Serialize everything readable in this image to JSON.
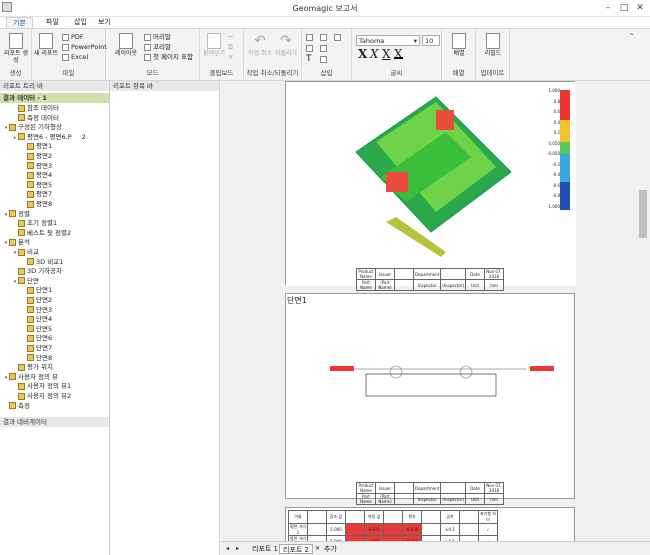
{
  "app": {
    "title": "Geomagic 보고서"
  },
  "tabs": [
    "기본",
    "파일",
    "삽입",
    "보기"
  ],
  "ribbon": {
    "create": {
      "label": "생성",
      "btn": "리포트 생성"
    },
    "file": {
      "label": "파일",
      "new": "새 리포트",
      "pdf": "PDF",
      "ppt": "PowerPoint",
      "excel": "Excel"
    },
    "mode": {
      "label": "모드",
      "layout": "레이아웃",
      "header": "머리말",
      "footer": "꼬리말",
      "first_page": "첫 페이지 표함"
    },
    "clipboard": {
      "label": "클립보드",
      "paste": "붙여넣기"
    },
    "undo": {
      "label": "작업 취소/되돌리기",
      "undo": "작업 취소",
      "redo": "되돌리기"
    },
    "insert": {
      "label": "삽입"
    },
    "font": {
      "label": "글씨",
      "name": "Tahoma",
      "size": "10",
      "styles": [
        "X",
        "X",
        "X",
        "X"
      ]
    },
    "arrange": {
      "label": "배열",
      "btn": "배열"
    },
    "update": {
      "label": "업데이트",
      "btn": "리빌드"
    }
  },
  "left": {
    "header": "리포트 트리 바",
    "result_data": "결과 데이터 - 1",
    "nav": "결과 네비게이터",
    "tree": [
      {
        "l": "참조 데이터",
        "d": 1,
        "y": 0
      },
      {
        "l": "측정 데이터",
        "d": 1,
        "y": 1
      },
      {
        "l": "구성된 기하형상",
        "d": 0,
        "y": 2,
        "ex": "▾"
      },
      {
        "l": "평면6 - 평면6.P",
        "d": 1,
        "y": 3,
        "ex": "▸",
        "n": "2"
      },
      {
        "l": "평면1",
        "d": 2,
        "y": 4
      },
      {
        "l": "평면2",
        "d": 2,
        "y": 5
      },
      {
        "l": "평면3",
        "d": 2,
        "y": 6
      },
      {
        "l": "평면4",
        "d": 2,
        "y": 7
      },
      {
        "l": "평면5",
        "d": 2,
        "y": 8
      },
      {
        "l": "평면7",
        "d": 2,
        "y": 9
      },
      {
        "l": "평면8",
        "d": 2,
        "y": 10
      },
      {
        "l": "정렬",
        "d": 0,
        "y": 11,
        "ex": "▾"
      },
      {
        "l": "초기 정렬1",
        "d": 1,
        "y": 12
      },
      {
        "l": "베스트 핏 정렬2",
        "d": 1,
        "y": 13
      },
      {
        "l": "분석",
        "d": 0,
        "y": 14,
        "ex": "▾"
      },
      {
        "l": "비교",
        "d": 1,
        "y": 15,
        "ex": "▾"
      },
      {
        "l": "3D 비교1",
        "d": 2,
        "y": 16
      },
      {
        "l": "3D 기하공차",
        "d": 1,
        "y": 17
      },
      {
        "l": "단면",
        "d": 1,
        "y": 18,
        "ex": "▾"
      },
      {
        "l": "단면1",
        "d": 2,
        "y": 19
      },
      {
        "l": "단면2",
        "d": 2,
        "y": 20
      },
      {
        "l": "단면3",
        "d": 2,
        "y": 21
      },
      {
        "l": "단면4",
        "d": 2,
        "y": 22
      },
      {
        "l": "단면5",
        "d": 2,
        "y": 23
      },
      {
        "l": "단면6",
        "d": 2,
        "y": 24
      },
      {
        "l": "단면7",
        "d": 2,
        "y": 25
      },
      {
        "l": "단면8",
        "d": 2,
        "y": 26
      },
      {
        "l": "평가 위치",
        "d": 1,
        "y": 27
      },
      {
        "l": "사용자 정의 뷰",
        "d": 0,
        "y": 28,
        "ex": "▾"
      },
      {
        "l": "사용자 정의 뷰1",
        "d": 1,
        "y": 29
      },
      {
        "l": "사용자 정의 뷰2",
        "d": 1,
        "y": 30
      },
      {
        "l": "측정",
        "d": 0,
        "y": 31
      }
    ]
  },
  "mid": {
    "header": "리포트 항목 바"
  },
  "doc": {
    "section": "단면1",
    "colorbar": [
      "1.000",
      "0.8",
      "0.6",
      "0.4",
      "0.2",
      "0.050",
      "-0.050",
      "-0.2",
      "-0.4",
      "-0.6",
      "-0.8",
      "-1.000"
    ],
    "title_row1": [
      "Product Name",
      "Issuer",
      "Department",
      "Date",
      "Nov 07, 2018"
    ],
    "title_row2": [
      "Part Name",
      "(Part Name)",
      "Inspector",
      "(Inspector)",
      "Unit",
      "mm"
    ],
    "mtable_hdr": [
      "이름",
      "참조 값",
      "측정 값",
      "편차",
      "공차",
      "표기형 차이"
    ],
    "mtable_rows": [
      [
        "평면 거리 1",
        "5.000",
        "4.970",
        "-0.030",
        "±0.1",
        "✓"
      ],
      [
        "평면 거리 2",
        "5.000",
        "4.981",
        "-0.019",
        "±0.1",
        "✓"
      ]
    ]
  },
  "status": {
    "tabs": [
      "리포트 1",
      "리포트 2",
      "추가"
    ]
  }
}
